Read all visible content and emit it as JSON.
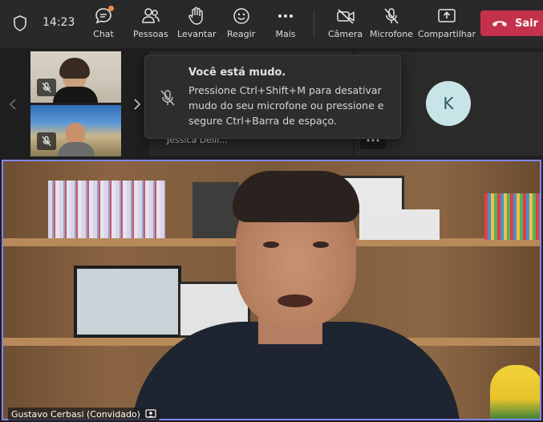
{
  "toolbar": {
    "time": "14:23",
    "buttons": [
      {
        "label": "Chat",
        "icon": "chat-icon"
      },
      {
        "label": "Pessoas",
        "icon": "people-icon"
      },
      {
        "label": "Levantar",
        "icon": "raise-hand-icon"
      },
      {
        "label": "Reagir",
        "icon": "react-icon"
      },
      {
        "label": "Mais",
        "icon": "more-icon"
      },
      {
        "label": "Câmera",
        "icon": "camera-off-icon"
      },
      {
        "label": "Microfone",
        "icon": "mic-off-icon"
      },
      {
        "label": "Compartilhar",
        "icon": "share-icon"
      }
    ],
    "leave_label": "Sair",
    "accent": "#c4314b"
  },
  "gallery": {
    "partial_name": "Jessica Delli...",
    "avatar_initial": "K"
  },
  "toast": {
    "title": "Você está mudo.",
    "body": "Pressione Ctrl+Shift+M para desativar mudo do seu microfone ou pressione e segure Ctrl+Barra de espaço."
  },
  "main_video": {
    "participant_name": "Gustavo Cerbasi (Convidado)",
    "border_color": "#7f85f5"
  }
}
